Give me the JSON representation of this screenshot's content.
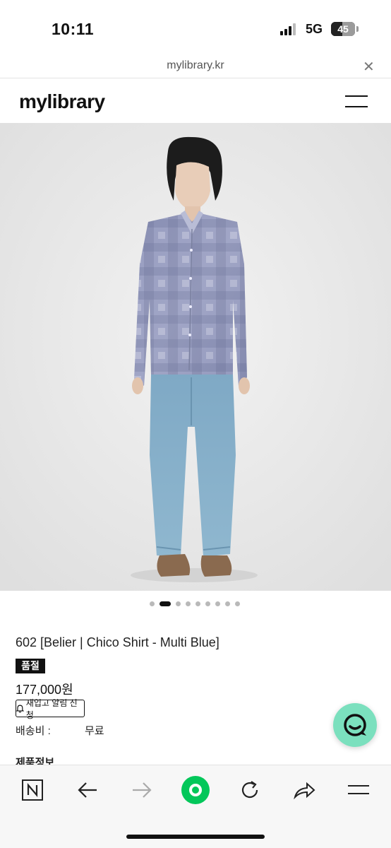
{
  "status_bar": {
    "time": "10:11",
    "network": "5G",
    "battery": "45"
  },
  "browser": {
    "url": "mylibrary.kr",
    "close_icon": "close-icon"
  },
  "site": {
    "logo": "mylibrary",
    "menu_icon": "hamburger-menu-icon"
  },
  "product": {
    "image_alt": "model wearing multi blue check shirt and light wash denim",
    "carousel": {
      "total": 9,
      "active": 2
    },
    "name": "602 [Belier | Chico Shirt - Multi Blue]",
    "soldout_label": "품절",
    "price": "177,000원",
    "restock_label": "재입고 알림 신청",
    "shipping_label": "배송비 :",
    "shipping_value": "무료",
    "info_title": "제품정보"
  },
  "toolbar": {
    "items": [
      "n-logo-icon",
      "back-arrow-icon",
      "forward-arrow-icon",
      "home-circle-icon",
      "refresh-icon",
      "share-icon",
      "menu-icon"
    ],
    "accent": "#03c75a"
  },
  "colors": {
    "chat_fab": "#7be0be",
    "badge_bg": "#111111"
  }
}
